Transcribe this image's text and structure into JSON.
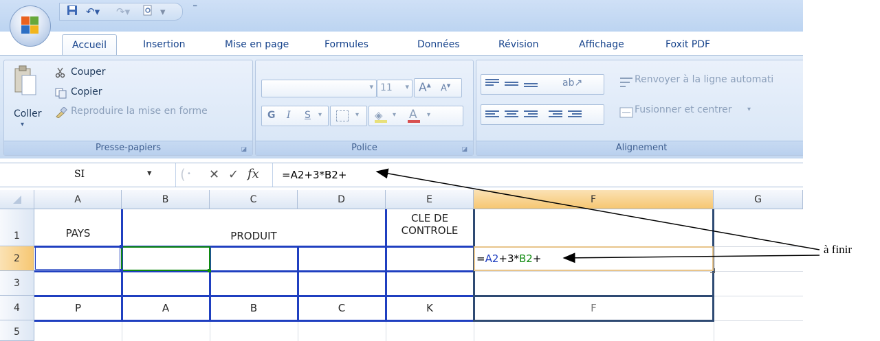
{
  "ribbon_tabs": [
    "Accueil",
    "Insertion",
    "Mise en page",
    "Formules",
    "Données",
    "Révision",
    "Affichage",
    "Foxit PDF"
  ],
  "active_tab": "Accueil",
  "clipboard": {
    "paste_label": "Coller",
    "cut_label": "Couper",
    "copy_label": "Copier",
    "format_painter_label": "Reproduire la mise en forme",
    "group_title": "Presse-papiers"
  },
  "font": {
    "size_value": "11",
    "bold_label": "G",
    "italic_label": "I",
    "underline_label": "S",
    "group_title": "Police"
  },
  "alignment": {
    "wrap_label": "Renvoyer à la ligne automati",
    "merge_label": "Fusionner et centrer",
    "group_title": "Alignement"
  },
  "formula_bar": {
    "name_box": "SI",
    "fx_label": "fx",
    "formula": "=A2+3*B2+"
  },
  "sheet": {
    "columns": [
      "A",
      "B",
      "C",
      "D",
      "E",
      "F",
      "G"
    ],
    "selected_column": "F",
    "rows": [
      "1",
      "2",
      "3",
      "4",
      "5"
    ],
    "selected_row": "2",
    "cells": {
      "A1": "PAYS",
      "B1": "PRODUIT",
      "E1_line1": "CLE DE",
      "E1_line2": "CONTROLE",
      "A4": "P",
      "B4": "A",
      "C4": "B",
      "D4": "C",
      "E4": "K",
      "F4": "F"
    },
    "editing_cell": {
      "ref": "F2",
      "part1": "=",
      "ref1": "A2",
      "part2": "+3*",
      "ref2": "B2",
      "part3": "+"
    }
  },
  "annotation": "à finir",
  "colors": {
    "ref1_color": "#1f3fc0",
    "ref2_color": "#108a10",
    "border_blue": "#1f3fc0",
    "selected_header": "#f6c772"
  }
}
